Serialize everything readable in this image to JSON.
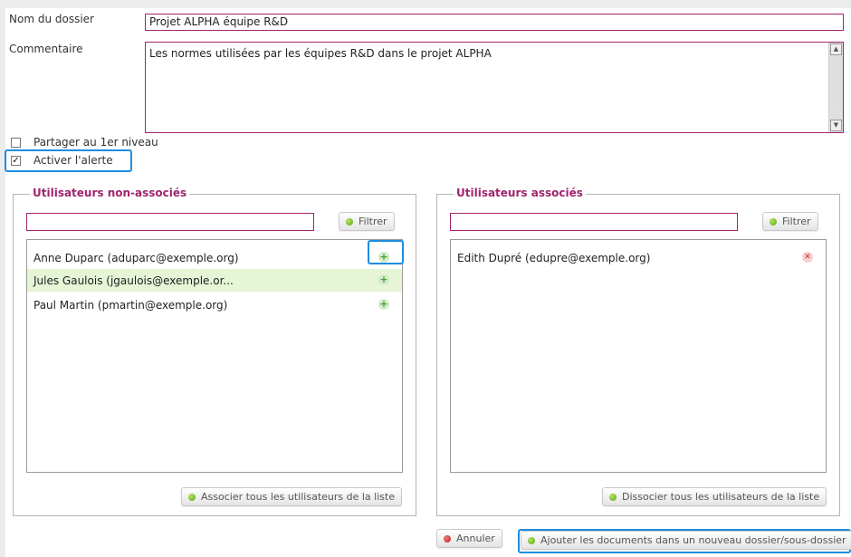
{
  "form": {
    "folder_name_label": "Nom du dossier",
    "folder_name_value": "Projet ALPHA équipe R&D",
    "comment_label": "Commentaire",
    "comment_value": "Les normes utilisées par les équipes R&D dans le projet ALPHA",
    "share_label": "Partager au 1er niveau",
    "share_checked": false,
    "alert_label": "Activer l'alerte",
    "alert_checked": true
  },
  "unassociated": {
    "title": "Utilisateurs non-associés",
    "filter_value": "",
    "filter_button": "Filtrer",
    "users": [
      {
        "label": "Anne Duparc (aduparc@exemple.org)",
        "action_icon": "plus-icon"
      },
      {
        "label": "Jules Gaulois (jgaulois@exemple.or...",
        "action_icon": "plus-icon",
        "selected": true
      },
      {
        "label": "Paul Martin (pmartin@exemple.org)",
        "action_icon": "plus-icon"
      }
    ],
    "associate_all_button": "Associer tous les utilisateurs de la liste"
  },
  "associated": {
    "title": "Utilisateurs associés",
    "filter_value": "",
    "filter_button": "Filtrer",
    "users": [
      {
        "label": "Edith Dupré (edupre@exemple.org)",
        "action_icon": "remove-icon"
      }
    ],
    "dissociate_all_button": "Dissocier tous les utilisateurs de la liste"
  },
  "footer": {
    "cancel_button": "Annuler",
    "submit_button": "Ajouter les documents dans un nouveau dossier/sous-dossier"
  },
  "colors": {
    "accent": "#a0246e",
    "highlight": "#1d8de0",
    "selected_row": "#e5f5d6",
    "ok_dot": "#5aa419",
    "cancel_dot": "#c31b1b"
  }
}
